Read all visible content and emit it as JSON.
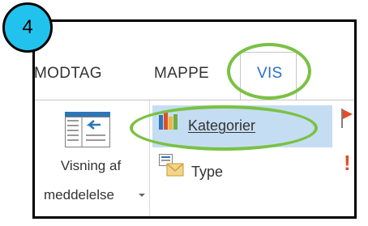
{
  "step": {
    "number": "4"
  },
  "ribbon": {
    "tabs": [
      {
        "label": "MODTAG"
      },
      {
        "label": "MAPPE"
      },
      {
        "label": "VIS",
        "active": true
      }
    ],
    "reading_pane": {
      "label_line1": "Visning af",
      "label_line2": "meddelelse",
      "icon": "reading-pane-icon"
    },
    "arrangement": [
      {
        "label": "Kategorier",
        "icon": "categories-icon",
        "selected": true
      },
      {
        "label": "Type",
        "icon": "type-icon",
        "selected": false
      }
    ],
    "side_icons": [
      "flag-icon",
      "importance-icon"
    ]
  },
  "colors": {
    "highlight_ring": "#7ac143",
    "step_badge": "#21c3ee",
    "active_tab_text": "#2a72c4",
    "selected_item": "#c5ddf2"
  }
}
